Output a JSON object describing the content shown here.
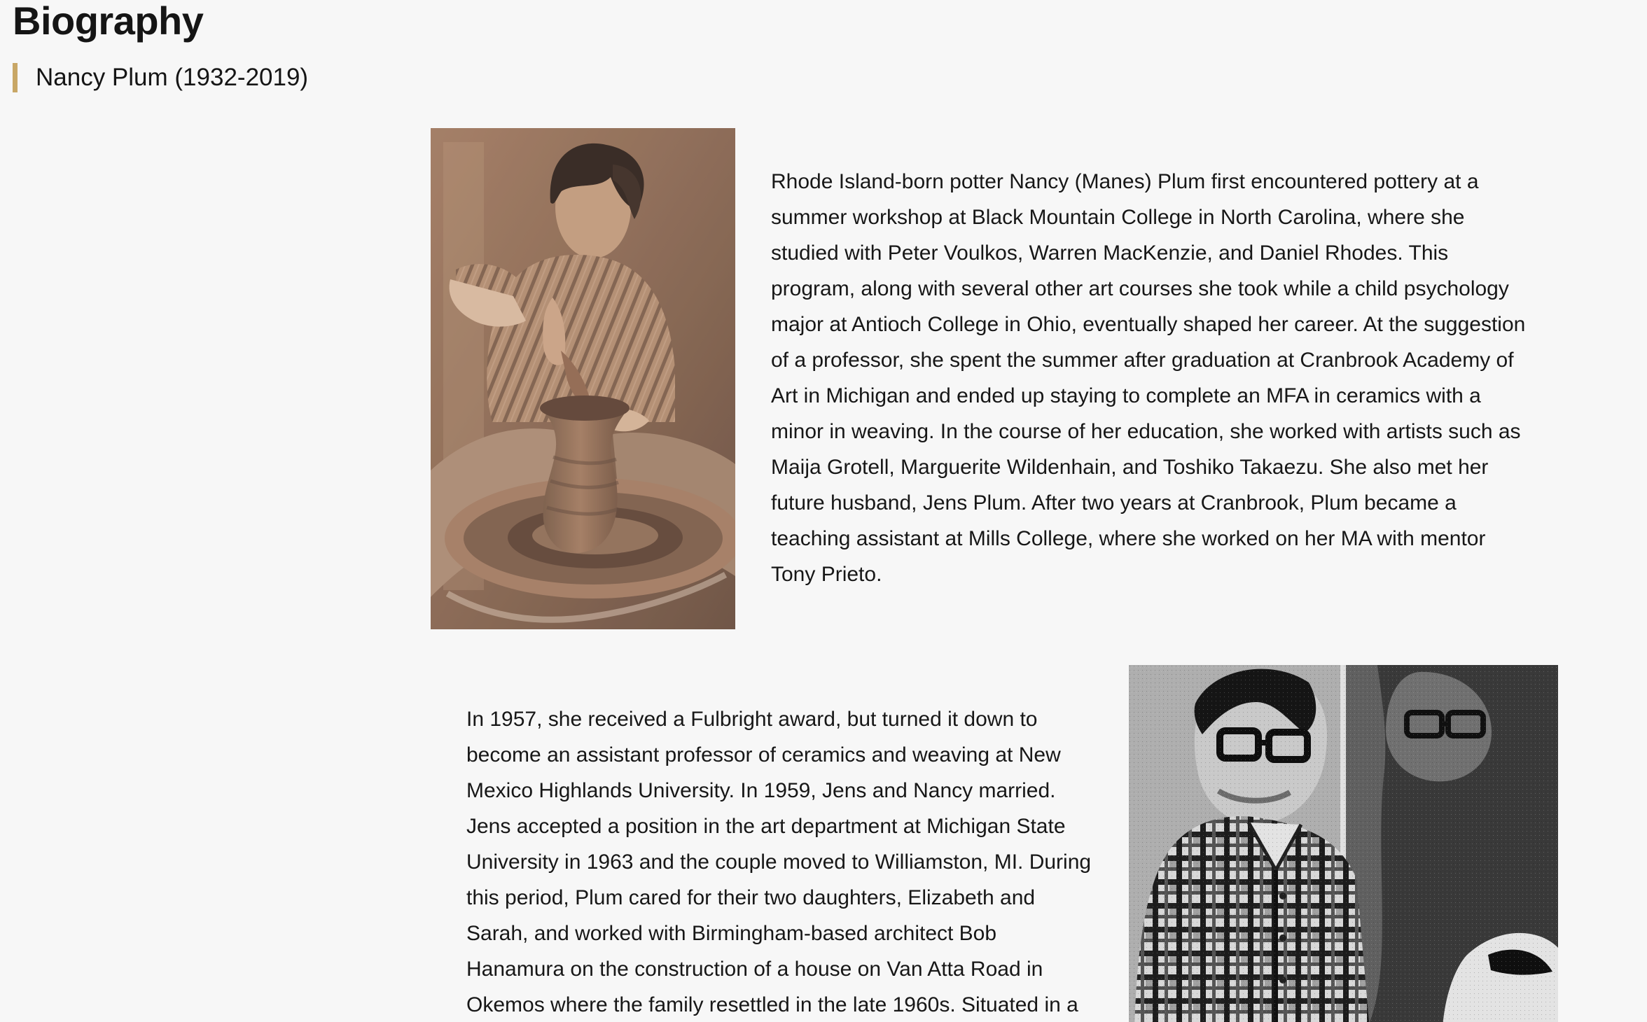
{
  "page": {
    "title": "Biography",
    "subtitle": "Nancy Plum (1932-2019)",
    "accent_color": "#c8a766",
    "background_color": "#f7f7f7"
  },
  "sections": [
    {
      "photo": {
        "icon": "potter-at-wheel-photo"
      },
      "text": "Rhode Island-born potter Nancy (Manes) Plum first encountered pottery at a summer workshop at Black Mountain College in North Carolina, where she studied with Peter Voulkos, Warren MacKenzie, and Daniel Rhodes. This program, along with several other art courses she took while a child psychology major at Antioch College in Ohio, eventually shaped her career. At the suggestion of a professor, she spent the summer after graduation at Cranbrook Academy of Art in Michigan and ended up staying to complete an MFA in ceramics with a minor in weaving. In the course of her education, she worked with artists such as Maija Grotell, Marguerite Wildenhain, and Toshiko Takaezu. She also met her future husband, Jens Plum. After two years at Cranbrook, Plum became a teaching assistant at Mills College, where she worked on her MA with mentor Tony Prieto."
    },
    {
      "photo": {
        "icon": "man-in-plaid-shirt-photo"
      },
      "text": "In 1957, she received a Fulbright award, but turned it down to become an assistant professor of ceramics and weaving at New Mexico Highlands University. In 1959, Jens and Nancy married. Jens accepted a position in the art department at Michigan State University in 1963 and the couple moved to Williamston, MI. During this period, Plum cared for their two daughters, Elizabeth and Sarah, and worked with Birmingham-based architect Bob Hanamura on the construction of a house on Van Atta Road in Okemos where the family resettled in the late 1960s. Situated in a"
    }
  ]
}
